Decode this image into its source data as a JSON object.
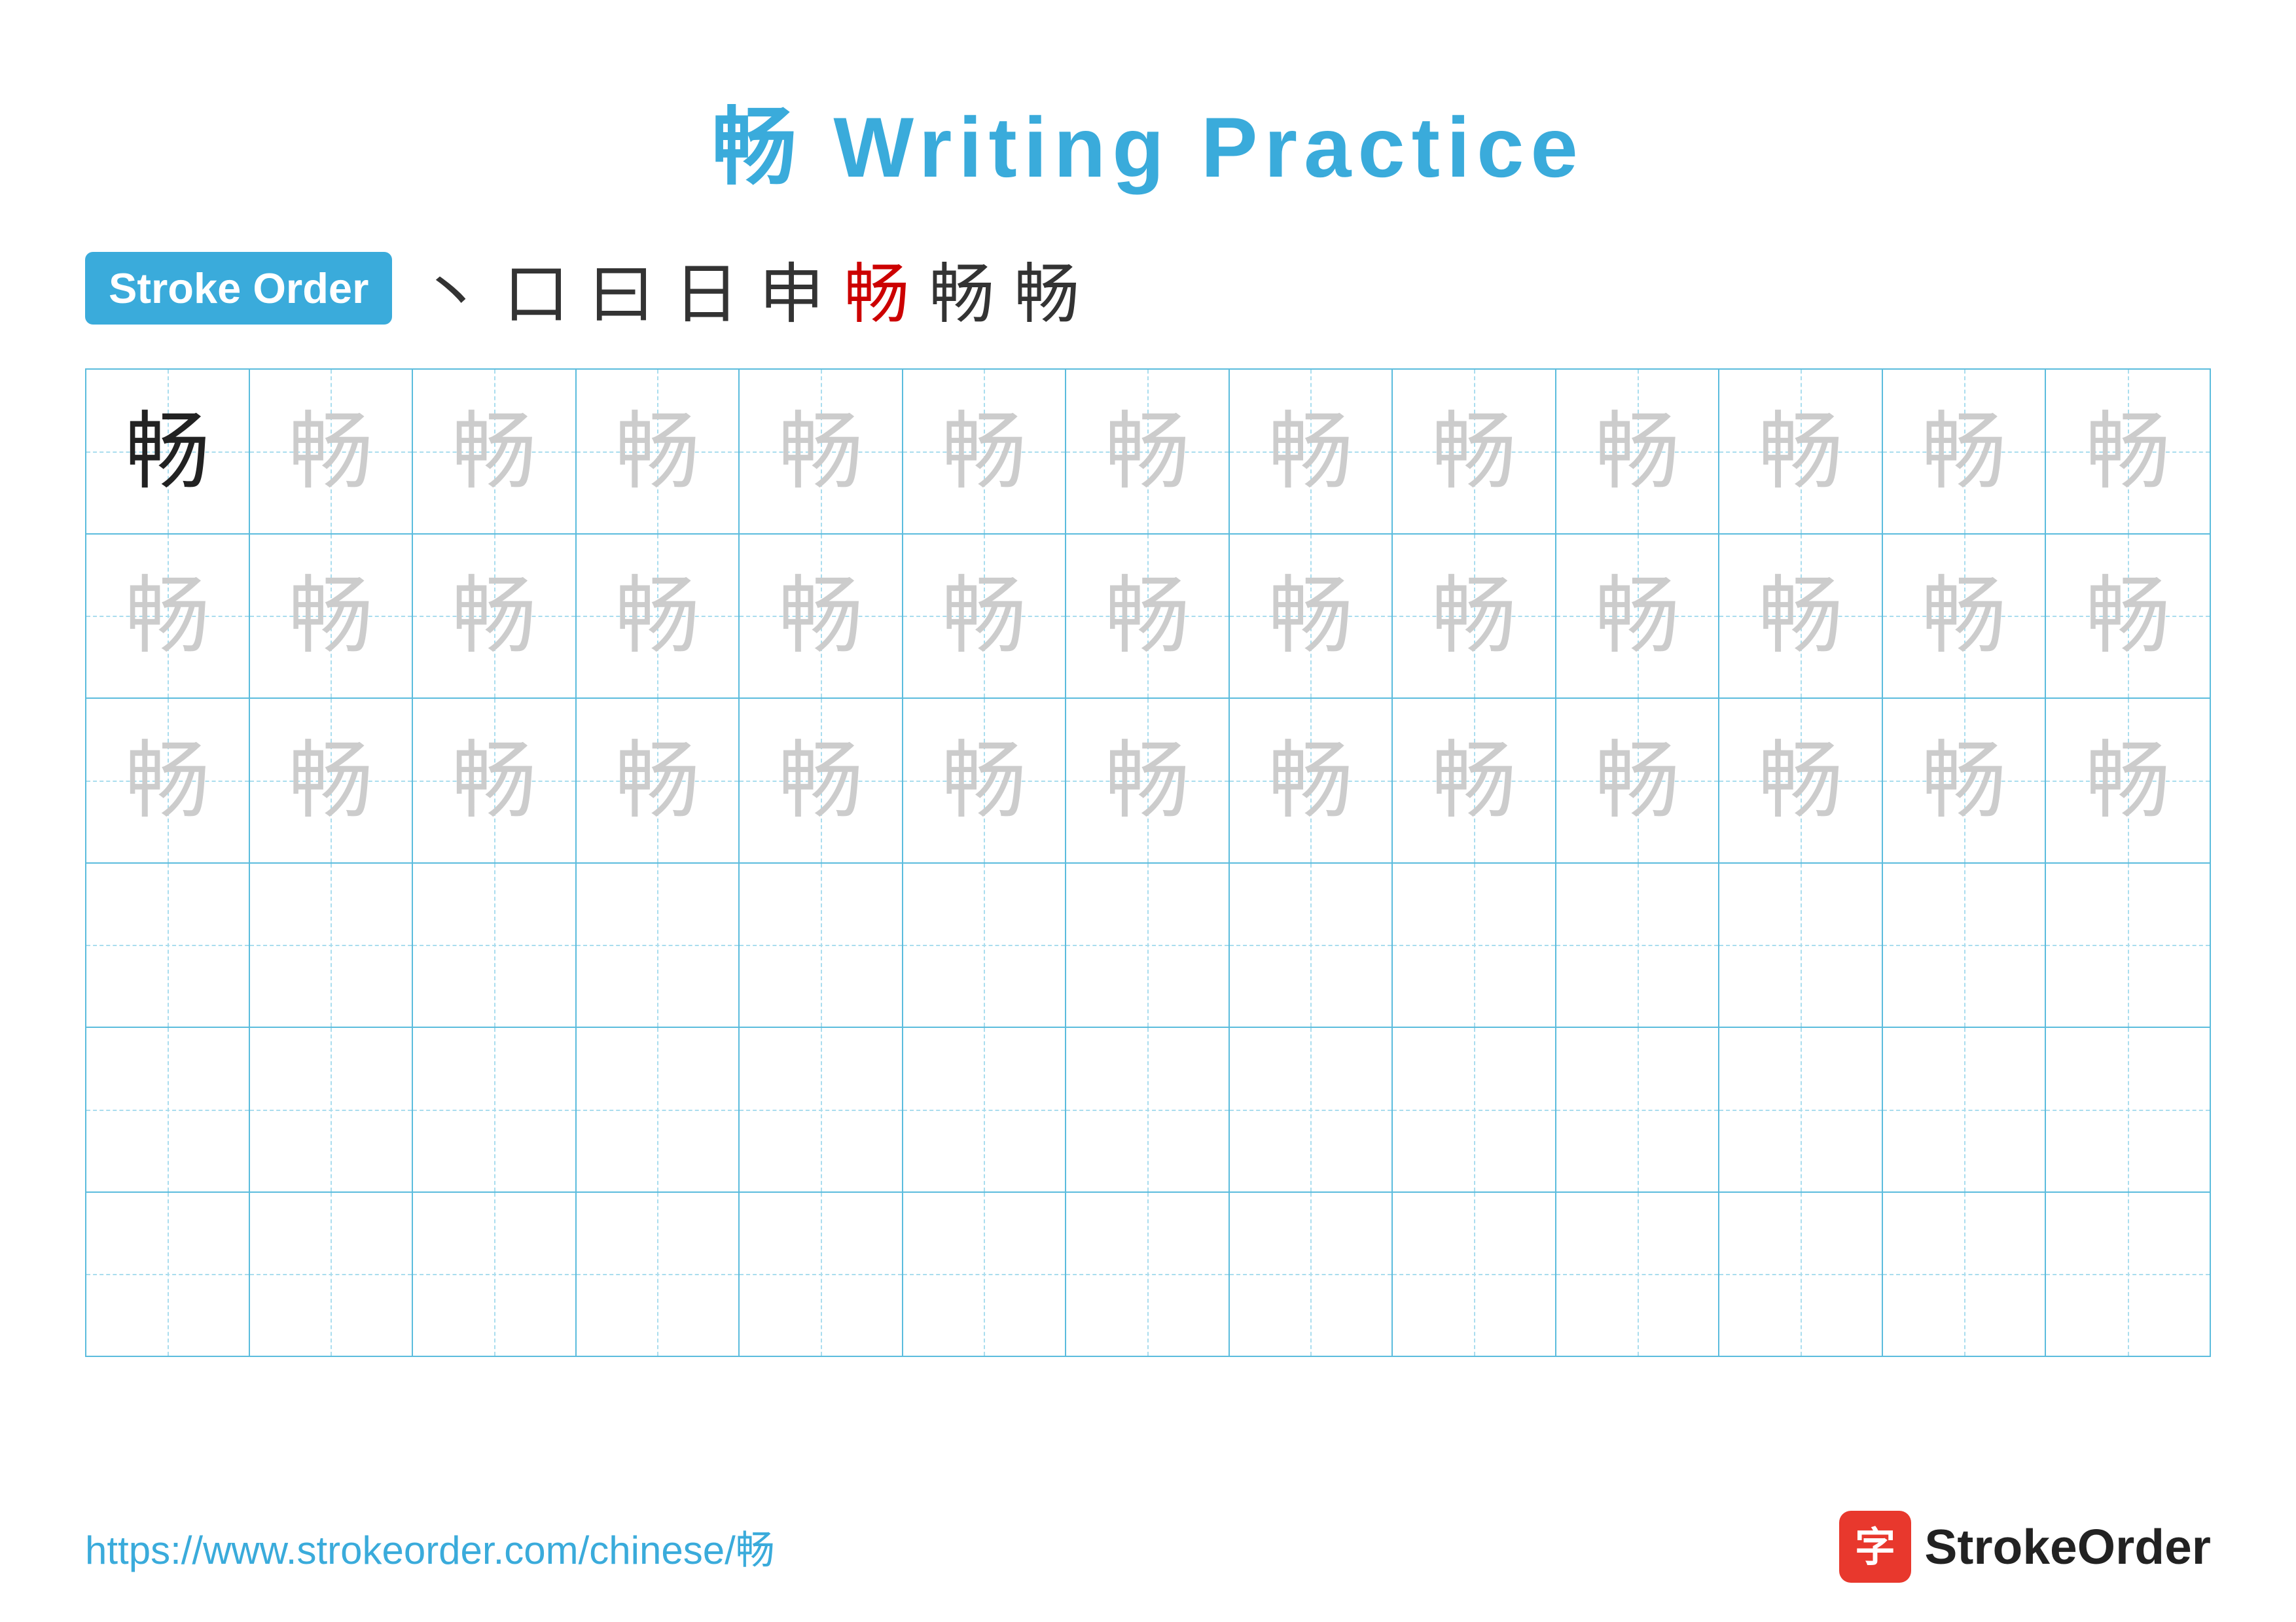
{
  "page": {
    "title": "畅 Writing Practice",
    "title_chinese": "畅",
    "title_rest": " Writing Practice"
  },
  "stroke_order": {
    "badge_label": "Stroke Order",
    "strokes": [
      "丶",
      "口",
      "曰",
      "日",
      "申",
      "畅",
      "畅",
      "畅"
    ],
    "red_index": 5
  },
  "grid": {
    "rows": 6,
    "cols": 13,
    "character": "畅",
    "filled_rows": [
      {
        "style": "dark",
        "count": 1,
        "rest": "light"
      },
      {
        "style": "light",
        "count": 13
      },
      {
        "style": "light",
        "count": 13
      },
      {
        "style": "empty",
        "count": 13
      },
      {
        "style": "empty",
        "count": 13
      },
      {
        "style": "empty",
        "count": 13
      }
    ]
  },
  "footer": {
    "url": "https://www.strokeorder.com/chinese/畅",
    "logo_text": "StrokeOrder"
  }
}
